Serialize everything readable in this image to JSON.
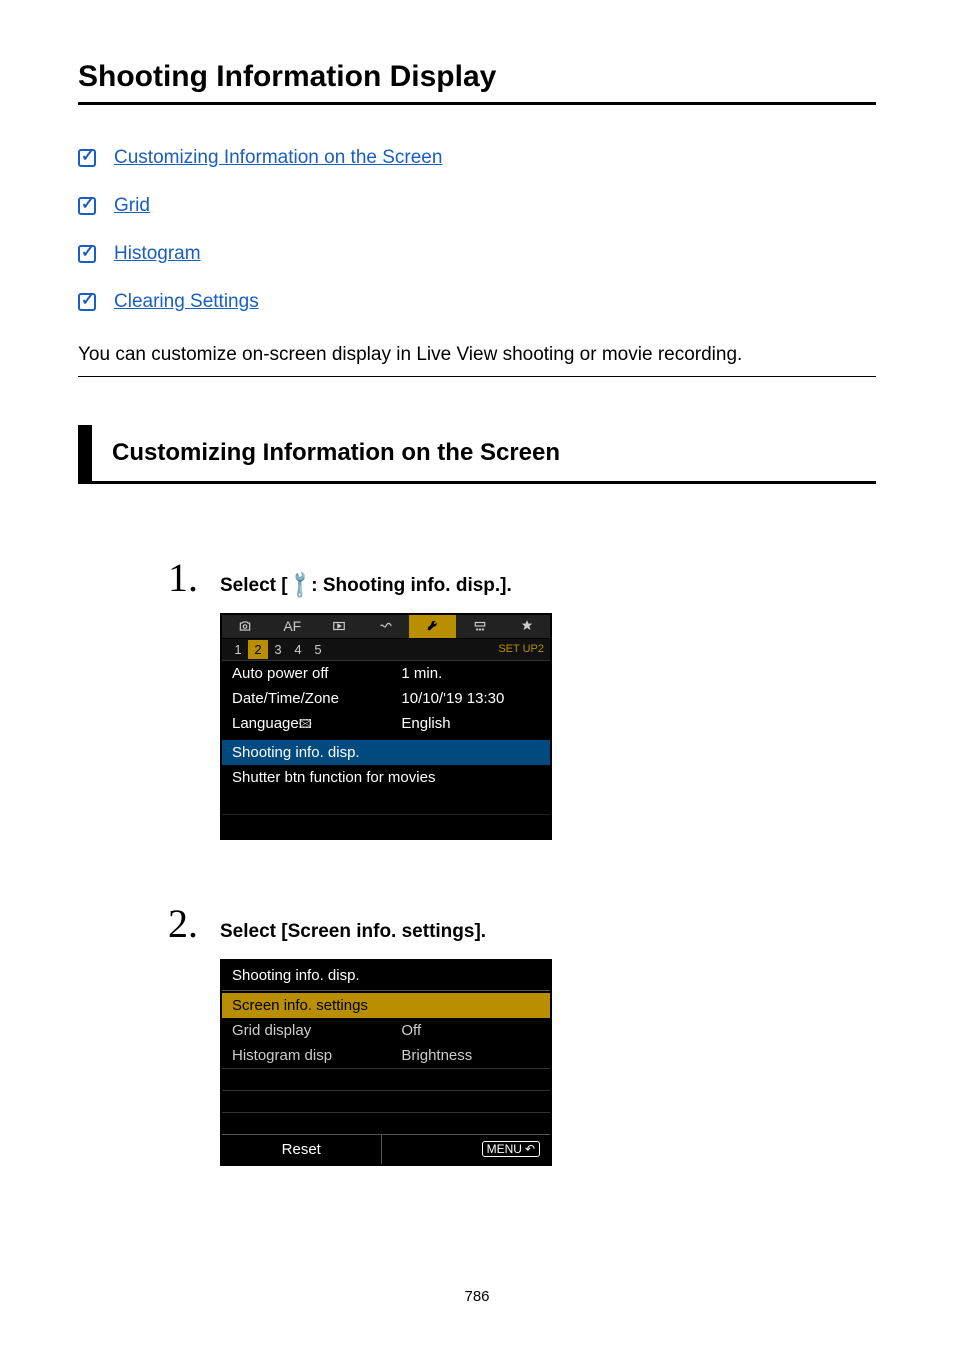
{
  "page": {
    "title": "Shooting Information Display",
    "number": "786"
  },
  "toc": [
    {
      "label": "Customizing Information on the Screen"
    },
    {
      "label": "Grid"
    },
    {
      "label": "Histogram"
    },
    {
      "label": "Clearing Settings"
    }
  ],
  "intro": "You can customize on-screen display in Live View shooting or movie recording.",
  "section_heading": "Customizing Information on the Screen",
  "steps": {
    "s1": {
      "num": "1.",
      "title_prefix": "Select [",
      "title_icon_alt": "wrench",
      "title_suffix": ": Shooting info. disp.]."
    },
    "s2": {
      "num": "2.",
      "title": "Select [Screen info. settings]."
    }
  },
  "cam1": {
    "tabs": {
      "shoot": "camera-icon",
      "af": "AF",
      "play": "play-icon",
      "net": "net-icon",
      "setup": "wrench-icon",
      "custom": "custom-icon",
      "star": "star-icon"
    },
    "subtabs": [
      "1",
      "2",
      "3",
      "4",
      "5"
    ],
    "setup_label": "SET UP2",
    "rows": [
      {
        "label": "Auto power off",
        "value": "1 min."
      },
      {
        "label": "Date/Time/Zone",
        "value": "10/10/'19 13:30"
      },
      {
        "label": "Language",
        "value": "English"
      },
      {
        "label": "Shooting info. disp.",
        "value": ""
      },
      {
        "label": "Shutter btn function for movies",
        "value": ""
      }
    ]
  },
  "cam2": {
    "header": "Shooting info. disp.",
    "highlight": "Screen info. settings",
    "rows": [
      {
        "label": "Grid display",
        "value": "Off"
      },
      {
        "label": "Histogram disp",
        "value": "Brightness"
      }
    ],
    "reset": "Reset",
    "menu": "MENU"
  }
}
